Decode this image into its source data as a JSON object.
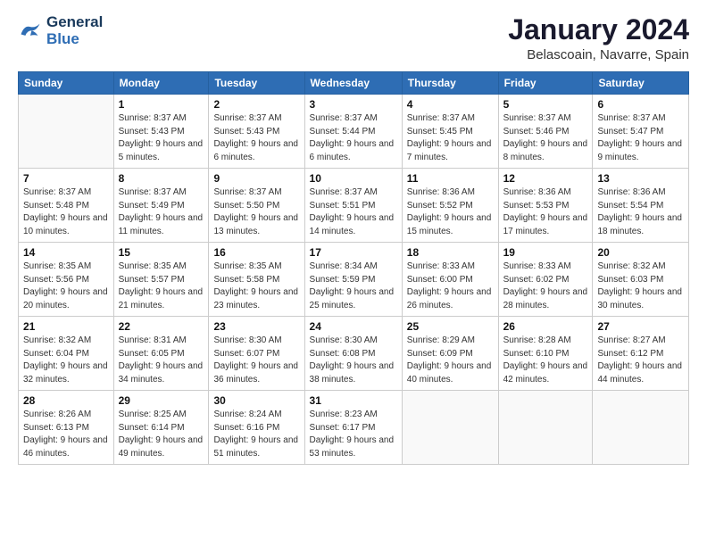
{
  "logo": {
    "line1": "General",
    "line2": "Blue"
  },
  "title": "January 2024",
  "subtitle": "Belascoain, Navarre, Spain",
  "days_header": [
    "Sunday",
    "Monday",
    "Tuesday",
    "Wednesday",
    "Thursday",
    "Friday",
    "Saturday"
  ],
  "weeks": [
    [
      {
        "day": "",
        "sunrise": "",
        "sunset": "",
        "daylight": ""
      },
      {
        "day": "1",
        "sunrise": "Sunrise: 8:37 AM",
        "sunset": "Sunset: 5:43 PM",
        "daylight": "Daylight: 9 hours and 5 minutes."
      },
      {
        "day": "2",
        "sunrise": "Sunrise: 8:37 AM",
        "sunset": "Sunset: 5:43 PM",
        "daylight": "Daylight: 9 hours and 6 minutes."
      },
      {
        "day": "3",
        "sunrise": "Sunrise: 8:37 AM",
        "sunset": "Sunset: 5:44 PM",
        "daylight": "Daylight: 9 hours and 6 minutes."
      },
      {
        "day": "4",
        "sunrise": "Sunrise: 8:37 AM",
        "sunset": "Sunset: 5:45 PM",
        "daylight": "Daylight: 9 hours and 7 minutes."
      },
      {
        "day": "5",
        "sunrise": "Sunrise: 8:37 AM",
        "sunset": "Sunset: 5:46 PM",
        "daylight": "Daylight: 9 hours and 8 minutes."
      },
      {
        "day": "6",
        "sunrise": "Sunrise: 8:37 AM",
        "sunset": "Sunset: 5:47 PM",
        "daylight": "Daylight: 9 hours and 9 minutes."
      }
    ],
    [
      {
        "day": "7",
        "sunrise": "Sunrise: 8:37 AM",
        "sunset": "Sunset: 5:48 PM",
        "daylight": "Daylight: 9 hours and 10 minutes."
      },
      {
        "day": "8",
        "sunrise": "Sunrise: 8:37 AM",
        "sunset": "Sunset: 5:49 PM",
        "daylight": "Daylight: 9 hours and 11 minutes."
      },
      {
        "day": "9",
        "sunrise": "Sunrise: 8:37 AM",
        "sunset": "Sunset: 5:50 PM",
        "daylight": "Daylight: 9 hours and 13 minutes."
      },
      {
        "day": "10",
        "sunrise": "Sunrise: 8:37 AM",
        "sunset": "Sunset: 5:51 PM",
        "daylight": "Daylight: 9 hours and 14 minutes."
      },
      {
        "day": "11",
        "sunrise": "Sunrise: 8:36 AM",
        "sunset": "Sunset: 5:52 PM",
        "daylight": "Daylight: 9 hours and 15 minutes."
      },
      {
        "day": "12",
        "sunrise": "Sunrise: 8:36 AM",
        "sunset": "Sunset: 5:53 PM",
        "daylight": "Daylight: 9 hours and 17 minutes."
      },
      {
        "day": "13",
        "sunrise": "Sunrise: 8:36 AM",
        "sunset": "Sunset: 5:54 PM",
        "daylight": "Daylight: 9 hours and 18 minutes."
      }
    ],
    [
      {
        "day": "14",
        "sunrise": "Sunrise: 8:35 AM",
        "sunset": "Sunset: 5:56 PM",
        "daylight": "Daylight: 9 hours and 20 minutes."
      },
      {
        "day": "15",
        "sunrise": "Sunrise: 8:35 AM",
        "sunset": "Sunset: 5:57 PM",
        "daylight": "Daylight: 9 hours and 21 minutes."
      },
      {
        "day": "16",
        "sunrise": "Sunrise: 8:35 AM",
        "sunset": "Sunset: 5:58 PM",
        "daylight": "Daylight: 9 hours and 23 minutes."
      },
      {
        "day": "17",
        "sunrise": "Sunrise: 8:34 AM",
        "sunset": "Sunset: 5:59 PM",
        "daylight": "Daylight: 9 hours and 25 minutes."
      },
      {
        "day": "18",
        "sunrise": "Sunrise: 8:33 AM",
        "sunset": "Sunset: 6:00 PM",
        "daylight": "Daylight: 9 hours and 26 minutes."
      },
      {
        "day": "19",
        "sunrise": "Sunrise: 8:33 AM",
        "sunset": "Sunset: 6:02 PM",
        "daylight": "Daylight: 9 hours and 28 minutes."
      },
      {
        "day": "20",
        "sunrise": "Sunrise: 8:32 AM",
        "sunset": "Sunset: 6:03 PM",
        "daylight": "Daylight: 9 hours and 30 minutes."
      }
    ],
    [
      {
        "day": "21",
        "sunrise": "Sunrise: 8:32 AM",
        "sunset": "Sunset: 6:04 PM",
        "daylight": "Daylight: 9 hours and 32 minutes."
      },
      {
        "day": "22",
        "sunrise": "Sunrise: 8:31 AM",
        "sunset": "Sunset: 6:05 PM",
        "daylight": "Daylight: 9 hours and 34 minutes."
      },
      {
        "day": "23",
        "sunrise": "Sunrise: 8:30 AM",
        "sunset": "Sunset: 6:07 PM",
        "daylight": "Daylight: 9 hours and 36 minutes."
      },
      {
        "day": "24",
        "sunrise": "Sunrise: 8:30 AM",
        "sunset": "Sunset: 6:08 PM",
        "daylight": "Daylight: 9 hours and 38 minutes."
      },
      {
        "day": "25",
        "sunrise": "Sunrise: 8:29 AM",
        "sunset": "Sunset: 6:09 PM",
        "daylight": "Daylight: 9 hours and 40 minutes."
      },
      {
        "day": "26",
        "sunrise": "Sunrise: 8:28 AM",
        "sunset": "Sunset: 6:10 PM",
        "daylight": "Daylight: 9 hours and 42 minutes."
      },
      {
        "day": "27",
        "sunrise": "Sunrise: 8:27 AM",
        "sunset": "Sunset: 6:12 PM",
        "daylight": "Daylight: 9 hours and 44 minutes."
      }
    ],
    [
      {
        "day": "28",
        "sunrise": "Sunrise: 8:26 AM",
        "sunset": "Sunset: 6:13 PM",
        "daylight": "Daylight: 9 hours and 46 minutes."
      },
      {
        "day": "29",
        "sunrise": "Sunrise: 8:25 AM",
        "sunset": "Sunset: 6:14 PM",
        "daylight": "Daylight: 9 hours and 49 minutes."
      },
      {
        "day": "30",
        "sunrise": "Sunrise: 8:24 AM",
        "sunset": "Sunset: 6:16 PM",
        "daylight": "Daylight: 9 hours and 51 minutes."
      },
      {
        "day": "31",
        "sunrise": "Sunrise: 8:23 AM",
        "sunset": "Sunset: 6:17 PM",
        "daylight": "Daylight: 9 hours and 53 minutes."
      },
      {
        "day": "",
        "sunrise": "",
        "sunset": "",
        "daylight": ""
      },
      {
        "day": "",
        "sunrise": "",
        "sunset": "",
        "daylight": ""
      },
      {
        "day": "",
        "sunrise": "",
        "sunset": "",
        "daylight": ""
      }
    ]
  ]
}
